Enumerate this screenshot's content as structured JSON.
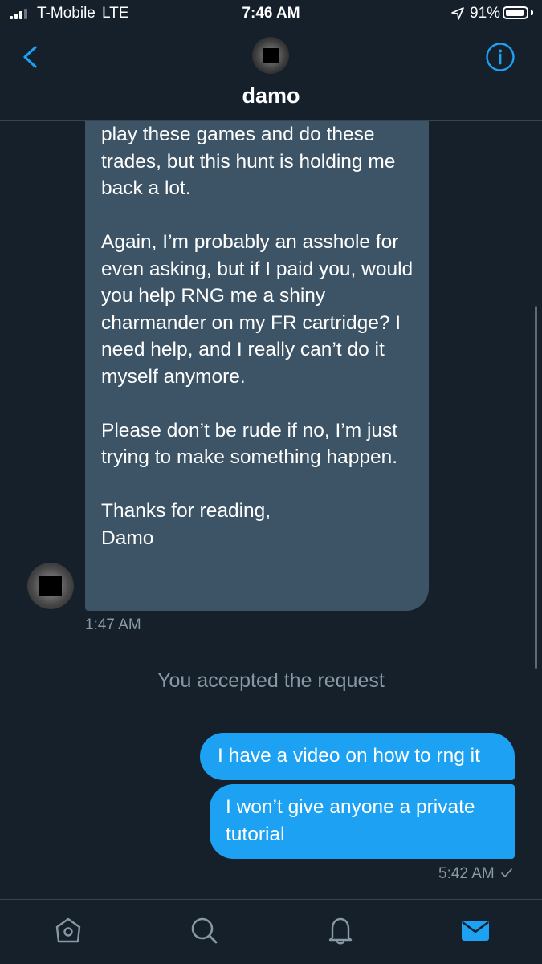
{
  "status_bar": {
    "carrier": "T-Mobile",
    "network": "LTE",
    "time": "7:46 AM",
    "battery_percent": "91%",
    "battery_level": 0.91
  },
  "header": {
    "title": "damo",
    "back_icon": "chevron-left-icon",
    "info_icon": "info-icon"
  },
  "messages": {
    "received": {
      "text": "play these games and do these trades, but this hunt is holding me back a lot.\n\nAgain, I’m probably an asshole for even asking, but if I paid you, would you help RNG me a shiny charmander on my FR cartridge? I need help, and I really can’t do it myself anymore.\n\nPlease don’t be rude if no, I’m just trying to make something happen.\n\nThanks for reading,\nDamo",
      "time": "1:47 AM"
    },
    "system_note": "You accepted the request",
    "sent": [
      {
        "text": "I have a video on how to rng it"
      },
      {
        "text": "I won’t give anyone a private tutorial"
      }
    ],
    "sent_time": "5:42 AM",
    "sent_status_icon": "checkmark-icon"
  },
  "tab_bar": {
    "tabs": [
      {
        "icon": "home-icon",
        "active": false
      },
      {
        "icon": "search-icon",
        "active": false
      },
      {
        "icon": "bell-icon",
        "active": false
      },
      {
        "icon": "mail-icon",
        "active": true
      }
    ]
  },
  "colors": {
    "background": "#15202b",
    "received_bubble": "#3d5466",
    "sent_bubble": "#1da1f2",
    "accent": "#1da1f2",
    "muted_text": "#8899a6"
  }
}
